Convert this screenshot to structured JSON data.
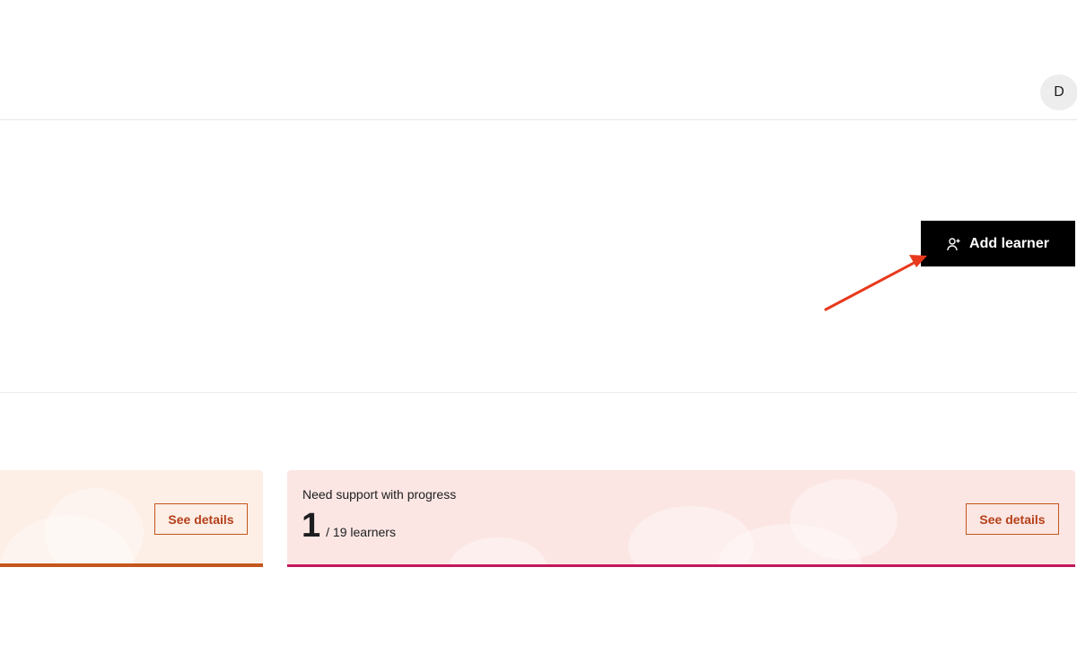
{
  "header": {
    "avatar_initial": "D"
  },
  "actions": {
    "add_learner_label": "Add learner",
    "add_learner_icon": "user-plus-icon"
  },
  "annotation": {
    "arrow_color": "#e8391d"
  },
  "cards": [
    {
      "details_label": "See details",
      "accent_color": "#c4561b"
    },
    {
      "title": "Need support with progress",
      "count": "1",
      "total_text": "/ 19 learners",
      "details_label": "See details",
      "accent_color": "#c2185b"
    }
  ]
}
